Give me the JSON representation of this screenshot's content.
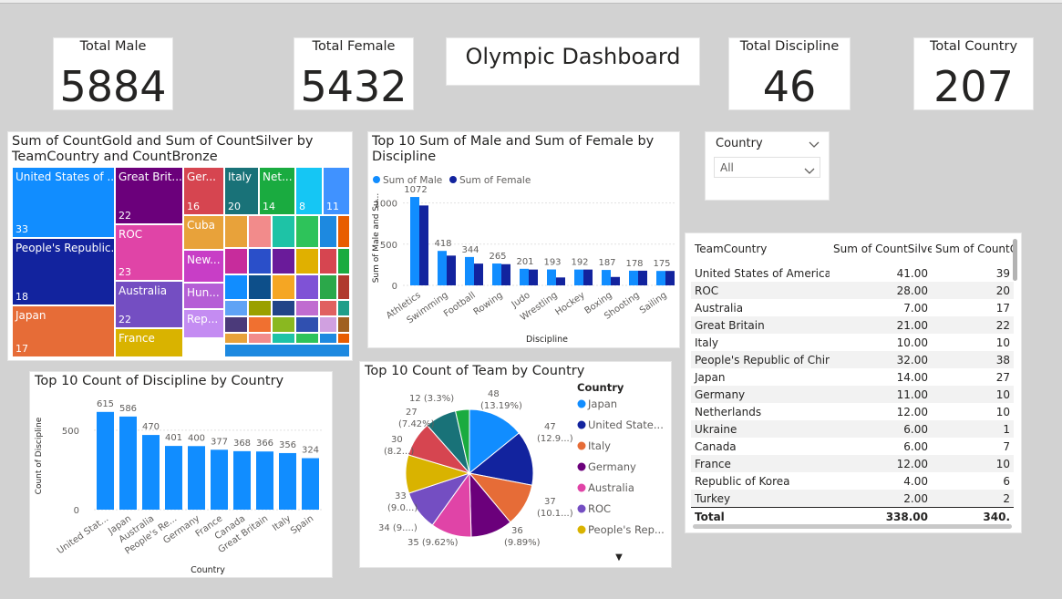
{
  "kpis": {
    "total_male": {
      "label": "Total Male",
      "value": "5884"
    },
    "total_female": {
      "label": "Total Female",
      "value": "5432"
    },
    "total_discipline": {
      "label": "Total Discipline",
      "value": "46"
    },
    "total_country": {
      "label": "Total Country",
      "value": "207"
    }
  },
  "dashboard_title": "Olympic Dashboard",
  "slicer": {
    "label": "Country",
    "selected": "All"
  },
  "treemap": {
    "title_line1": "Sum of CountGold and Sum of CountSilver by",
    "title_line2": "TeamCountry and CountBronze",
    "tiles": [
      {
        "name": "United States of ...",
        "value": "33",
        "color": "#118dff"
      },
      {
        "name": "People's Republic...",
        "value": "18",
        "color": "#12239e"
      },
      {
        "name": "Japan",
        "value": "17",
        "color": "#e66c37"
      },
      {
        "name": "Great Brit...",
        "value": "22",
        "color": "#6b007b"
      },
      {
        "name": "ROC",
        "value": "23",
        "color": "#e044a7"
      },
      {
        "name": "Australia",
        "value": "22",
        "color": "#744ec2"
      },
      {
        "name": "France",
        "value": "",
        "color": "#d9b300"
      },
      {
        "name": "Ger...",
        "value": "16",
        "color": "#d64550"
      },
      {
        "name": "Cuba",
        "value": "",
        "color": "#e8a23a"
      },
      {
        "name": "New...",
        "value": "",
        "color": "#c83ec6"
      },
      {
        "name": "Hun...",
        "value": "",
        "color": "#b55ed6"
      },
      {
        "name": "Rep...",
        "value": "",
        "color": "#c48cf2"
      },
      {
        "name": "Italy",
        "value": "20",
        "color": "#197278"
      },
      {
        "name": "Net...",
        "value": "14",
        "color": "#1aab40"
      },
      {
        "name": "",
        "value": "8",
        "color": "#15c6f4"
      },
      {
        "name": "",
        "value": "11",
        "color": "#4092ff"
      }
    ]
  },
  "gender_chart": {
    "title_line1": "Top 10 Sum of Male and Sum of Female by",
    "title_line2": "Discipline",
    "legend_male": "Sum of Male",
    "legend_female": "Sum of Female",
    "ylabel": "Sum of Male and Su...",
    "xlabel": "Discipline",
    "yticks": [
      "1000",
      "500",
      "0"
    ],
    "colors": {
      "male": "#118dff",
      "female": "#12239e"
    }
  },
  "discipline_chart": {
    "title": "Top 10 Count of Discipline by Country",
    "ylabel": "Count of Discipline",
    "xlabel": "Country",
    "yticks": [
      "500",
      "0"
    ],
    "color": "#118dff"
  },
  "pie_chart": {
    "title": "Top 10 Count of Team by Country",
    "legend_title": "Country",
    "labels": [
      {
        "line1": "48",
        "line2": "(13.19%)"
      },
      {
        "line1": "47",
        "line2": "(12.9...)"
      },
      {
        "line1": "37",
        "line2": "(10.1...)"
      },
      {
        "line1": "36",
        "line2": "(9.89%)"
      },
      {
        "line1": "35 (9.62%)",
        "line2": ""
      },
      {
        "line1": "34 (9....)",
        "line2": ""
      },
      {
        "line1": "33",
        "line2": "(9.0...)"
      },
      {
        "line1": "30",
        "line2": "(8.2...)"
      },
      {
        "line1": "27",
        "line2": "(7.42%)"
      },
      {
        "line1": "12 (3.3%)",
        "line2": ""
      }
    ],
    "legend": [
      "Japan",
      "United State...",
      "Italy",
      "Germany",
      "Australia",
      "ROC",
      "People's Rep..."
    ],
    "more_indicator": "▼"
  },
  "table": {
    "headers": [
      "TeamCountry",
      "Sum of CountSilver",
      "Sum of CountGo"
    ],
    "rows": [
      [
        "United States of America",
        "41.00",
        "39"
      ],
      [
        "ROC",
        "28.00",
        "20"
      ],
      [
        "Australia",
        "7.00",
        "17"
      ],
      [
        "Great Britain",
        "21.00",
        "22"
      ],
      [
        "Italy",
        "10.00",
        "10"
      ],
      [
        "People's Republic of China",
        "32.00",
        "38"
      ],
      [
        "Japan",
        "14.00",
        "27"
      ],
      [
        "Germany",
        "11.00",
        "10"
      ],
      [
        "Netherlands",
        "12.00",
        "10"
      ],
      [
        "Ukraine",
        "6.00",
        "1"
      ],
      [
        "Canada",
        "6.00",
        "7"
      ],
      [
        "France",
        "12.00",
        "10"
      ],
      [
        "Republic of Korea",
        "4.00",
        "6"
      ],
      [
        "Turkey",
        "2.00",
        "2"
      ]
    ],
    "total": [
      "Total",
      "338.00",
      "340."
    ]
  },
  "chart_data": [
    {
      "type": "bar",
      "title": "Top 10 Sum of Male and Sum of Female by Discipline",
      "xlabel": "Discipline",
      "ylabel": "Sum of Male and Su...",
      "categories": [
        "Athletics",
        "Swimming",
        "Football",
        "Rowing",
        "Judo",
        "Wrestling",
        "Hockey",
        "Boxing",
        "Shooting",
        "Sailing"
      ],
      "series": [
        {
          "name": "Sum of Male",
          "values": [
            1072,
            418,
            344,
            265,
            201,
            193,
            192,
            187,
            178,
            175
          ]
        },
        {
          "name": "Sum of Female",
          "values": [
            969,
            361,
            264,
            257,
            192,
            96,
            192,
            102,
            178,
            175
          ]
        }
      ],
      "ylim": [
        0,
        1150
      ],
      "legend": "top-left"
    },
    {
      "type": "bar",
      "title": "Top 10 Count of Discipline by Country",
      "xlabel": "Country",
      "ylabel": "Count of Discipline",
      "categories": [
        "United Stat...",
        "Japan",
        "Australia",
        "People's Re...",
        "Germany",
        "France",
        "Canada",
        "Great Britain",
        "Italy",
        "Spain"
      ],
      "values": [
        615,
        586,
        470,
        401,
        400,
        377,
        368,
        366,
        356,
        324
      ],
      "ylim": [
        0,
        700
      ]
    },
    {
      "type": "pie",
      "title": "Top 10 Count of Team by Country",
      "categories": [
        "Japan",
        "United State...",
        "Italy",
        "Germany",
        "Australia",
        "ROC",
        "People's Rep...",
        "",
        "",
        ""
      ],
      "values": [
        48,
        47,
        37,
        36,
        35,
        34,
        33,
        30,
        27,
        12
      ],
      "colors": [
        "#118dff",
        "#12239e",
        "#e66c37",
        "#6b007b",
        "#e044a7",
        "#744ec2",
        "#d9b300",
        "#d64550",
        "#197278",
        "#1aab40"
      ],
      "legend": "right"
    }
  ]
}
